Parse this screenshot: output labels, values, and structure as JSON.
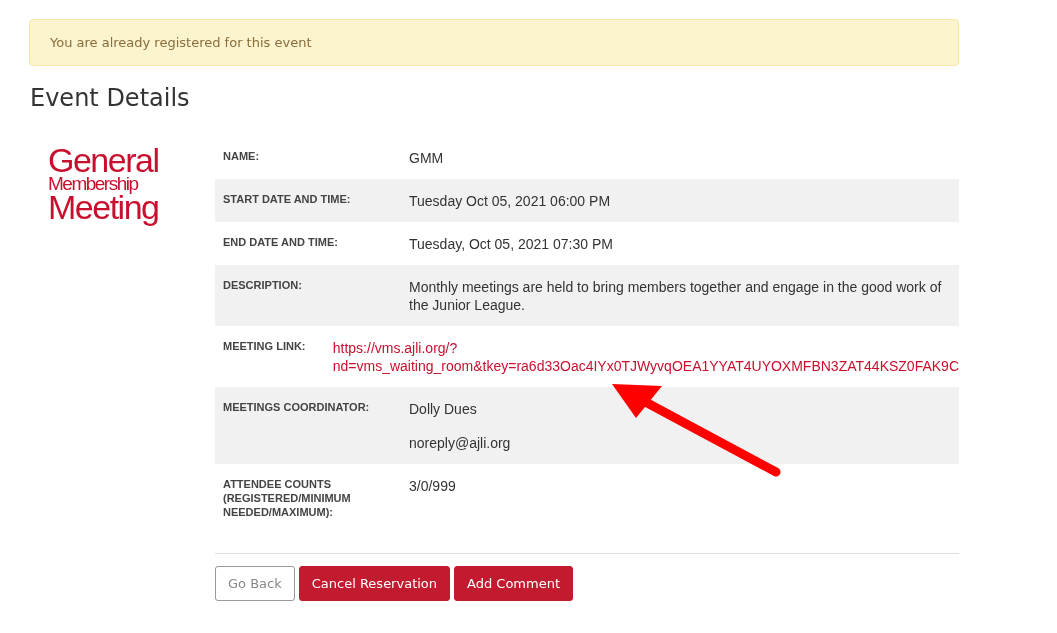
{
  "alert": {
    "text": "You are already registered for this event"
  },
  "title": "Event Details",
  "logo": {
    "lines": [
      "General",
      "Membership",
      "Meeting"
    ]
  },
  "details": [
    {
      "label": "NAME:",
      "kind": "text",
      "lines": [
        "GMM"
      ]
    },
    {
      "label": "START DATE AND TIME:",
      "kind": "text",
      "lines": [
        "Tuesday Oct 05, 2021 06:00 PM"
      ]
    },
    {
      "label": "END DATE AND TIME:",
      "kind": "text",
      "lines": [
        "Tuesday, Oct 05, 2021 07:30 PM"
      ]
    },
    {
      "label": "DESCRIPTION:",
      "kind": "text",
      "lines": [
        "Monthly meetings are held to bring members together and engage in the good work of the Junior League."
      ]
    },
    {
      "label": "MEETING LINK:",
      "kind": "link",
      "lines": [
        "https://vms.ajli.org/?",
        "nd=vms_waiting_room&tkey=ra6d33Oac4IYx0TJWyvqOEA1YYAT4UYOXMFBN3ZAT44KSZ0FAK9C"
      ]
    },
    {
      "label": "MEETINGS COORDINATOR:",
      "kind": "text",
      "lines": [
        "Dolly Dues",
        "noreply@ajli.org"
      ]
    },
    {
      "label": "ATTENDEE COUNTS (REGISTERED/MINIMUM NEEDED/MAXIMUM):",
      "kind": "text",
      "lines": [
        "3/0/999"
      ]
    }
  ],
  "buttons": [
    {
      "label": "Go Back",
      "kind": "outline"
    },
    {
      "label": "Cancel Reservation",
      "kind": "primary"
    },
    {
      "label": "Add Comment",
      "kind": "primary"
    }
  ]
}
